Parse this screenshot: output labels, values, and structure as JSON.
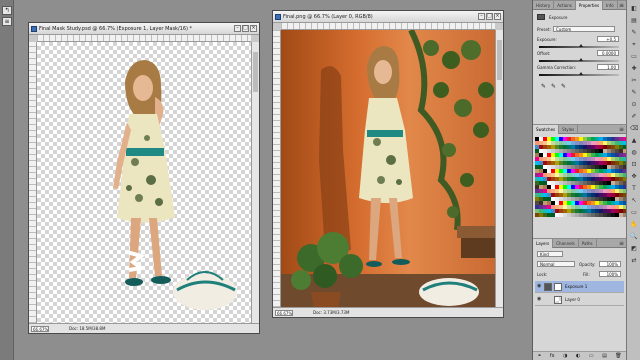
{
  "left_toolbar": {
    "tools": [
      "↰",
      "≡"
    ]
  },
  "doc_left": {
    "title": "Final Mask Study.psd @ 66.7% (Exposure 1, Layer Mask/16) *",
    "zoom": "66.67%",
    "doc_info": "Doc: 18.5M/38.8M",
    "win_buttons": [
      "–",
      "□",
      "×"
    ]
  },
  "doc_right": {
    "title": "Final.png @ 66.7% (Layer 0, RGB/8)",
    "zoom": "66.67%",
    "doc_info": "Doc: 3.73M/3.73M",
    "win_buttons": [
      "–",
      "□",
      "×"
    ]
  },
  "properties_panel": {
    "tabs": [
      "History",
      "Actions",
      "Properties",
      "Info"
    ],
    "panel_menu_icon": "≡",
    "adjustment_title": "Exposure",
    "preset_label": "Preset:",
    "preset_value": "Custom",
    "exposure_label": "Exposure:",
    "exposure_value": "+0.5",
    "offset_label": "Offset:",
    "offset_value": "0.0000",
    "gamma_label": "Gamma Correction:",
    "gamma_value": "1.00",
    "eyedroppers": [
      "✎",
      "✎",
      "✎"
    ]
  },
  "swatches_panel": {
    "tabs": [
      "Swatches",
      "Styles"
    ],
    "panel_menu_icon": "≡",
    "colors": [
      "#000000",
      "#ffffff",
      "#ff0000",
      "#ffff00",
      "#00ff00",
      "#00ffff",
      "#0000ff",
      "#ff00ff",
      "#ed1c24",
      "#f26522",
      "#f7941d",
      "#fff200",
      "#8dc63f",
      "#39b54a",
      "#00a651",
      "#00a99d",
      "#00aeef",
      "#0072bc",
      "#0054a6",
      "#2e3192",
      "#662d91",
      "#92278f",
      "#ec008c",
      "#f69679",
      "#f9ad81",
      "#fdc689",
      "#fff79a",
      "#c4df9b",
      "#a3d39c",
      "#82ca9c",
      "#7accc8",
      "#6dcff6",
      "#7da7d9",
      "#8393ca",
      "#8781bd",
      "#a187be",
      "#bd8cbf",
      "#f49ac1",
      "#f5989d",
      "#fbaf5d",
      "#fff568",
      "#acd373",
      "#7cc576",
      "#3cb878",
      "#1cbbb4",
      "#00bff3",
      "#448ccb",
      "#9e0b0f",
      "#a0410d",
      "#a36209",
      "#aba000",
      "#598527",
      "#1a7b30",
      "#007236",
      "#00746b",
      "#0076a3",
      "#004a80",
      "#003471",
      "#1b1464",
      "#440e62",
      "#630460",
      "#9e005d",
      "#9e0039",
      "#790000",
      "#7b2e00",
      "#7d4900",
      "#827b00",
      "#406618",
      "#005e20",
      "#005826",
      "#ffffff",
      "#eeeeee",
      "#dddddd",
      "#cccccc",
      "#bbbbbb",
      "#aaaaaa",
      "#999999",
      "#888888",
      "#777777",
      "#666666",
      "#555555",
      "#444444",
      "#333333",
      "#222222",
      "#111111",
      "#000000",
      "#c7b299",
      "#998675",
      "#736357",
      "#534741",
      "#37302d",
      "#c69c6d",
      "#a67c52"
    ]
  },
  "layers_panel": {
    "tabs": [
      "Layers",
      "Channels",
      "Paths"
    ],
    "panel_menu_icon": "≡",
    "kind_label": "Kind",
    "blend_mode": "Normal",
    "opacity_label": "Opacity:",
    "opacity_value": "100%",
    "lock_label": "Lock:",
    "fill_label": "Fill:",
    "fill_value": "100%",
    "layers": [
      {
        "name": "Exposure 1",
        "selected": true
      },
      {
        "name": "Layer 0",
        "selected": false
      }
    ],
    "bottom_icons": [
      "⚭",
      "fx",
      "◑",
      "◐",
      "▭",
      "▤",
      "🗑"
    ]
  },
  "right_toolbar": {
    "tools": [
      "◧",
      "▤",
      "✎",
      "⌖",
      "▭",
      "✚",
      "✂",
      "✎",
      "⊙",
      "✐",
      "⌫",
      "▲",
      "◍",
      "⊡",
      "✥",
      "T",
      "↖",
      "▭",
      "✋",
      "🔍",
      "◩",
      "⇄"
    ]
  }
}
